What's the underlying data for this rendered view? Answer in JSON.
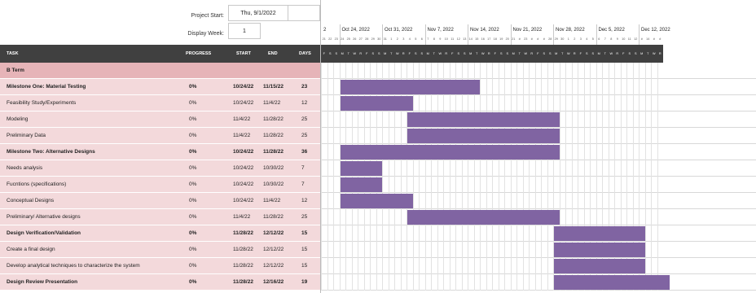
{
  "header": {
    "project_start_label": "Project Start:",
    "project_start_value": "Thu, 9/1/2022",
    "display_week_label": "Display Week:",
    "display_week_value": "1"
  },
  "table": {
    "columns": [
      "TASK",
      "PROGRESS",
      "START",
      "END",
      "DAYS"
    ],
    "rows": [
      {
        "kind": "term",
        "task": "B Term",
        "progress": "",
        "start": "",
        "end": "",
        "days": ""
      },
      {
        "kind": "milestone",
        "task": "Milestone One: Material Testing",
        "progress": "0%",
        "start": "10/24/22",
        "end": "11/15/22",
        "days": "23",
        "bar": [
          "10/24",
          "11/15"
        ]
      },
      {
        "kind": "task",
        "task": "Feasibility Study/Experiments",
        "progress": "0%",
        "start": "10/24/22",
        "end": "11/4/22",
        "days": "12",
        "bar": [
          "10/24",
          "11/4"
        ]
      },
      {
        "kind": "task",
        "task": "Modeling",
        "progress": "0%",
        "start": "11/4/22",
        "end": "11/28/22",
        "days": "25",
        "bar": [
          "11/4",
          "11/28"
        ]
      },
      {
        "kind": "task",
        "task": "Preliminary Data",
        "progress": "0%",
        "start": "11/4/22",
        "end": "11/28/22",
        "days": "25",
        "bar": [
          "11/4",
          "11/28"
        ]
      },
      {
        "kind": "milestone",
        "task": "Milestone Two: Alternative Designs",
        "progress": "0%",
        "start": "10/24/22",
        "end": "11/28/22",
        "days": "36",
        "bar": [
          "10/24",
          "11/28"
        ]
      },
      {
        "kind": "task",
        "task": "Needs analysis",
        "progress": "0%",
        "start": "10/24/22",
        "end": "10/30/22",
        "days": "7",
        "bar": [
          "10/24",
          "10/30"
        ]
      },
      {
        "kind": "task",
        "task": "Fucntions (specifications)",
        "progress": "0%",
        "start": "10/24/22",
        "end": "10/30/22",
        "days": "7",
        "bar": [
          "10/24",
          "10/30"
        ]
      },
      {
        "kind": "task",
        "task": "Conceptual Designs",
        "progress": "0%",
        "start": "10/24/22",
        "end": "11/4/22",
        "days": "12",
        "bar": [
          "10/24",
          "11/4"
        ]
      },
      {
        "kind": "task",
        "task": "Preliminary/ Alternative designs",
        "progress": "0%",
        "start": "11/4/22",
        "end": "11/28/22",
        "days": "25",
        "bar": [
          "11/4",
          "11/28"
        ]
      },
      {
        "kind": "milestone",
        "task": "Design Verification/Validation",
        "progress": "0%",
        "start": "11/28/22",
        "end": "12/12/22",
        "days": "15",
        "bar": [
          "11/28",
          "12/12"
        ]
      },
      {
        "kind": "task",
        "task": "Create a final design",
        "progress": "0%",
        "start": "11/28/22",
        "end": "12/12/22",
        "days": "15",
        "bar": [
          "11/28",
          "12/12"
        ]
      },
      {
        "kind": "task",
        "task": "Develop analytical techniques to characterize the system",
        "progress": "0%",
        "start": "11/28/22",
        "end": "12/12/22",
        "days": "15",
        "bar": [
          "11/28",
          "12/12"
        ]
      },
      {
        "kind": "milestone",
        "task": "Design Review Presentation",
        "progress": "0%",
        "start": "11/28/22",
        "end": "12/16/22",
        "days": "19",
        "bar": [
          "11/28",
          "12/16"
        ]
      }
    ]
  },
  "timeline": {
    "weeks": [
      "2",
      "Oct 24, 2022",
      "Oct 31, 2022",
      "Nov 7, 2022",
      "Nov 14, 2022",
      "Nov 21, 2022",
      "Nov 28, 2022",
      "Dec 5, 2022",
      "Dec 12, 2022"
    ],
    "day_numbers": [
      "21",
      "22",
      "23",
      "24",
      "25",
      "26",
      "27",
      "28",
      "29",
      "30",
      "31",
      "1",
      "2",
      "3",
      "4",
      "5",
      "6",
      "7",
      "8",
      "9",
      "10",
      "11",
      "12",
      "13",
      "14",
      "15",
      "16",
      "17",
      "18",
      "19",
      "20",
      "21",
      "#",
      "23",
      "#",
      "#",
      "#",
      "28",
      "29",
      "30",
      "1",
      "2",
      "3",
      "4",
      "5",
      "6",
      "7",
      "8",
      "9",
      "10",
      "11",
      "12",
      "#",
      "14",
      "#",
      "#"
    ],
    "day_letters": [
      "F",
      "S",
      "S",
      "M",
      "T",
      "W",
      "R",
      "F",
      "S",
      "S",
      "M",
      "T",
      "W",
      "R",
      "F",
      "S",
      "S",
      "M",
      "T",
      "W",
      "R",
      "F",
      "S",
      "S",
      "M",
      "T",
      "W",
      "R",
      "F",
      "S",
      "S",
      "M",
      "T",
      "W",
      "R",
      "F",
      "S",
      "S",
      "M",
      "T",
      "W",
      "R",
      "F",
      "S",
      "S",
      "M",
      "T",
      "W",
      "R",
      "F",
      "S",
      "S",
      "M",
      "T",
      "W",
      "R"
    ],
    "dates": [
      "10/21",
      "10/22",
      "10/23",
      "10/24",
      "10/25",
      "10/26",
      "10/27",
      "10/28",
      "10/29",
      "10/30",
      "10/31",
      "11/1",
      "11/2",
      "11/3",
      "11/4",
      "11/5",
      "11/6",
      "11/7",
      "11/8",
      "11/9",
      "11/10",
      "11/11",
      "11/12",
      "11/13",
      "11/14",
      "11/15",
      "11/16",
      "11/17",
      "11/18",
      "11/19",
      "11/20",
      "11/21",
      "11/22",
      "11/23",
      "11/24",
      "11/25",
      "11/26",
      "11/27",
      "11/28",
      "11/29",
      "11/30",
      "12/1",
      "12/2",
      "12/3",
      "12/4",
      "12/5",
      "12/6",
      "12/7",
      "12/8",
      "12/9",
      "12/10",
      "12/11",
      "12/12",
      "12/13",
      "12/14",
      "12/15",
      "12/16"
    ],
    "bar_color": "#8064a2"
  }
}
